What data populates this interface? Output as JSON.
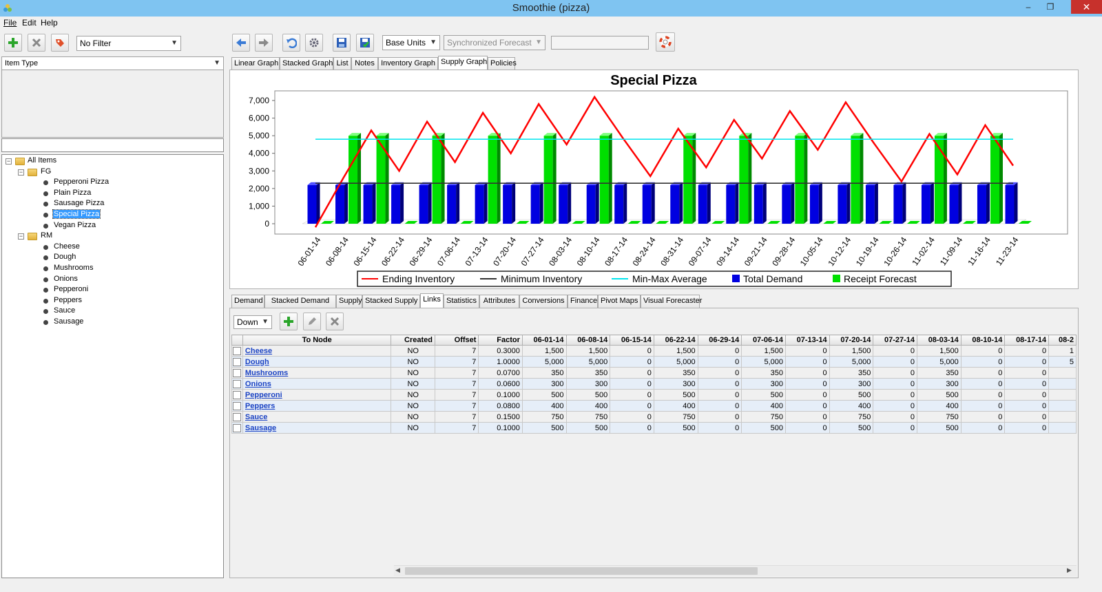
{
  "window": {
    "title": "Smoothie (pizza)",
    "minimize": "–",
    "restore": "❐",
    "close": "✕"
  },
  "menu": [
    {
      "label": "File"
    },
    {
      "label": "Edit"
    },
    {
      "label": "Help"
    }
  ],
  "left": {
    "filter_value": "No Filter",
    "item_type": "Item Type",
    "tree": {
      "root": "All Items",
      "groups": [
        {
          "label": "FG",
          "items": [
            "Pepperoni Pizza",
            "Plain Pizza",
            "Sausage Pizza",
            "Special Pizza",
            "Vegan Pizza"
          ]
        },
        {
          "label": "RM",
          "items": [
            "Cheese",
            "Dough",
            "Mushrooms",
            "Onions",
            "Pepperoni",
            "Peppers",
            "Sauce",
            "Sausage"
          ]
        }
      ],
      "selected": "Special Pizza"
    }
  },
  "toolbar": {
    "units": "Base Units",
    "forecast": "Synchronized Forecast"
  },
  "top_tabs": [
    "Linear Graph",
    "Stacked Graph",
    "List",
    "Notes",
    "Inventory Graph",
    "Supply Graph",
    "Policies"
  ],
  "top_tab_active": "Supply Graph",
  "bottom_tabs": [
    "Demand",
    "Stacked Demand",
    "Supply",
    "Stacked Supply",
    "Links",
    "Statistics",
    "Attributes",
    "Conversions",
    "Finance",
    "Pivot Maps",
    "Visual Forecaster"
  ],
  "bottom_tab_active": "Links",
  "links": {
    "direction": "Down",
    "columns": [
      "To Node",
      "Created",
      "Offset",
      "Factor",
      "06-01-14",
      "06-08-14",
      "06-15-14",
      "06-22-14",
      "06-29-14",
      "07-06-14",
      "07-13-14",
      "07-20-14",
      "07-27-14",
      "08-03-14",
      "08-10-14",
      "08-17-14",
      "08-2"
    ],
    "rows": [
      [
        "Cheese",
        "NO",
        "7",
        "0.3000",
        "1,500",
        "1,500",
        "0",
        "1,500",
        "0",
        "1,500",
        "0",
        "1,500",
        "0",
        "1,500",
        "0",
        "0",
        "1"
      ],
      [
        "Dough",
        "NO",
        "7",
        "1.0000",
        "5,000",
        "5,000",
        "0",
        "5,000",
        "0",
        "5,000",
        "0",
        "5,000",
        "0",
        "5,000",
        "0",
        "0",
        "5"
      ],
      [
        "Mushrooms",
        "NO",
        "7",
        "0.0700",
        "350",
        "350",
        "0",
        "350",
        "0",
        "350",
        "0",
        "350",
        "0",
        "350",
        "0",
        "0",
        ""
      ],
      [
        "Onions",
        "NO",
        "7",
        "0.0600",
        "300",
        "300",
        "0",
        "300",
        "0",
        "300",
        "0",
        "300",
        "0",
        "300",
        "0",
        "0",
        ""
      ],
      [
        "Pepperoni",
        "NO",
        "7",
        "0.1000",
        "500",
        "500",
        "0",
        "500",
        "0",
        "500",
        "0",
        "500",
        "0",
        "500",
        "0",
        "0",
        ""
      ],
      [
        "Peppers",
        "NO",
        "7",
        "0.0800",
        "400",
        "400",
        "0",
        "400",
        "0",
        "400",
        "0",
        "400",
        "0",
        "400",
        "0",
        "0",
        ""
      ],
      [
        "Sauce",
        "NO",
        "7",
        "0.1500",
        "750",
        "750",
        "0",
        "750",
        "0",
        "750",
        "0",
        "750",
        "0",
        "750",
        "0",
        "0",
        ""
      ],
      [
        "Sausage",
        "NO",
        "7",
        "0.1000",
        "500",
        "500",
        "0",
        "500",
        "0",
        "500",
        "0",
        "500",
        "0",
        "500",
        "0",
        "0",
        ""
      ]
    ]
  },
  "chart_data": {
    "type": "bar",
    "title": "Special Pizza",
    "xlabel": "",
    "ylabel": "",
    "ylim": [
      0,
      7000
    ],
    "yticks": [
      "7,000",
      "6,000",
      "5,000",
      "4,000",
      "3,000",
      "2,000",
      "1,000",
      "0"
    ],
    "yticks_values": [
      7000,
      6000,
      5000,
      4000,
      3000,
      2000,
      1000,
      0
    ],
    "categories": [
      "06-01-14",
      "06-08-14",
      "06-15-14",
      "06-22-14",
      "06-29-14",
      "07-06-14",
      "07-13-14",
      "07-20-14",
      "07-27-14",
      "08-03-14",
      "08-10-14",
      "08-17-14",
      "08-24-14",
      "08-31-14",
      "09-07-14",
      "09-14-14",
      "09-21-14",
      "09-28-14",
      "10-05-14",
      "10-12-14",
      "10-19-14",
      "10-26-14",
      "11-02-14",
      "11-09-14",
      "11-16-14",
      "11-23-14"
    ],
    "series": [
      {
        "name": "Ending Inventory",
        "kind": "line",
        "color": "#ff0000",
        "values": [
          -200,
          2600,
          5300,
          3000,
          5800,
          3500,
          6300,
          4000,
          6800,
          4500,
          7200,
          4900,
          2700,
          5400,
          3200,
          5900,
          3700,
          6400,
          4200,
          6900,
          4600,
          2400,
          5100,
          2800,
          5600,
          3300
        ]
      },
      {
        "name": "Minimum Inventory",
        "kind": "line",
        "color": "#333333",
        "values": [
          2300,
          2300,
          2300,
          2300,
          2300,
          2300,
          2300,
          2300,
          2300,
          2300,
          2300,
          2300,
          2300,
          2300,
          2300,
          2300,
          2300,
          2300,
          2300,
          2300,
          2300,
          2300,
          2300,
          2300,
          2300,
          2300
        ]
      },
      {
        "name": "Min-Max Average",
        "kind": "line",
        "color": "#00e5ee",
        "values": [
          4800,
          4800,
          4800,
          4800,
          4800,
          4800,
          4800,
          4800,
          4800,
          4800,
          4800,
          4800,
          4800,
          4800,
          4800,
          4800,
          4800,
          4800,
          4800,
          4800,
          4800,
          4800,
          4800,
          4800,
          4800,
          4800
        ]
      },
      {
        "name": "Total Demand",
        "kind": "bar",
        "color": "#0000e0",
        "values": [
          2200,
          2200,
          2200,
          2200,
          2200,
          2200,
          2200,
          2200,
          2200,
          2200,
          2200,
          2200,
          2200,
          2200,
          2200,
          2200,
          2200,
          2200,
          2200,
          2200,
          2200,
          2200,
          2200,
          2200,
          2200,
          2200
        ]
      },
      {
        "name": "Receipt Forecast",
        "kind": "bar",
        "color": "#00e000",
        "values": [
          0,
          5000,
          5000,
          0,
          5000,
          0,
          5000,
          0,
          5000,
          0,
          5000,
          0,
          0,
          5000,
          0,
          5000,
          0,
          5000,
          0,
          5000,
          0,
          0,
          5000,
          0,
          5000,
          0
        ]
      }
    ],
    "legend_position": "bottom",
    "grid": false
  }
}
